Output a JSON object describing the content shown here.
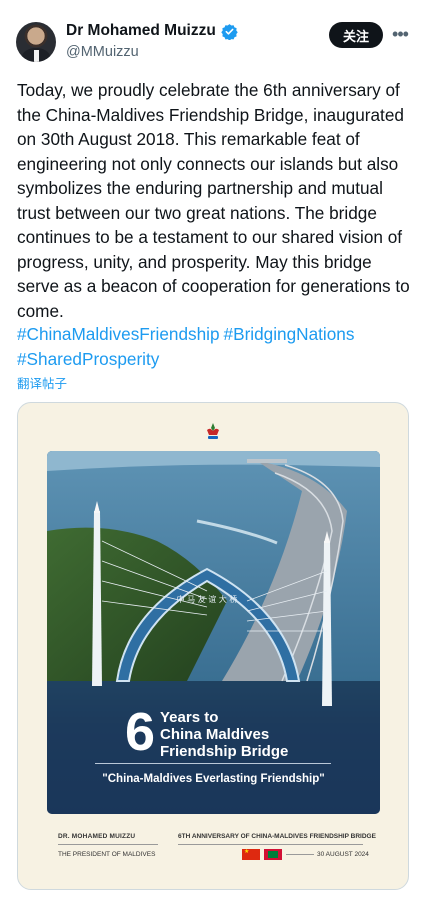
{
  "author": {
    "name": "Dr Mohamed Muizzu",
    "handle": "@MMuizzu",
    "follow_label": "关注",
    "more_label": "•••"
  },
  "tweet": {
    "text": "Today, we proudly celebrate the 6th anniversary of the China-Maldives Friendship Bridge, inaugurated on 30th August 2018. This remarkable feat of engineering not only connects our islands but also symbolizes the enduring partnership and mutual trust between our two great nations. The bridge continues to be a testament to our shared vision of progress, unity, and prosperity. May this bridge serve as a beacon of cooperation for generations to come.",
    "hashtags": [
      "#ChinaMaldivesFriendship",
      "#BridgingNations",
      "#SharedProsperity"
    ],
    "translate_label": "翻译帖子"
  },
  "poster": {
    "number": "6",
    "years_line": "Years to",
    "line1": "China Maldives",
    "line2": "Friendship Bridge",
    "quote": "\"China-Maldives Everlasting Friendship\"",
    "arch_text": "中 马 友 谊 大 桥",
    "footer_name": "DR. MOHAMED MUIZZU",
    "footer_title": "THE PRESIDENT OF MALDIVES",
    "footer_event": "6TH ANNIVERSARY OF CHINA-MALDIVES FRIENDSHIP BRIDGE",
    "footer_date": "30 AUGUST 2024"
  },
  "colors": {
    "accent": "#1d9bf0",
    "verified": "#1d9bf0",
    "poster_blue": "#1d3a5c"
  },
  "icons": [
    "verified-badge-icon",
    "more-icon",
    "emblem-icon",
    "china-flag-icon",
    "maldives-flag-icon"
  ]
}
